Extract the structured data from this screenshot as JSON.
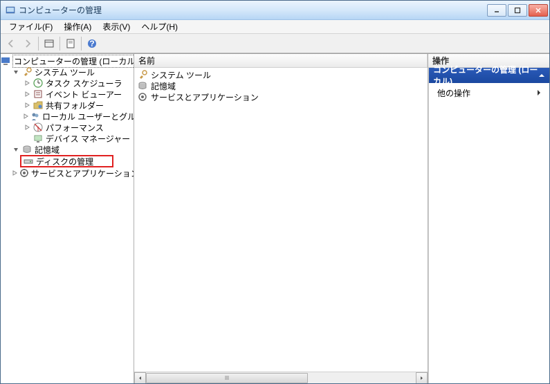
{
  "window": {
    "title": "コンピューターの管理"
  },
  "menu": {
    "file": "ファイル(F)",
    "action": "操作(A)",
    "view": "表示(V)",
    "help": "ヘルプ(H)"
  },
  "tree": {
    "root": "コンピューターの管理 (ローカル)",
    "system_tools": "システム ツール",
    "task_scheduler": "タスク スケジューラ",
    "event_viewer": "イベント ビューアー",
    "shared_folders": "共有フォルダー",
    "local_users": "ローカル ユーザーとグループ",
    "performance": "パフォーマンス",
    "device_manager": "デバイス マネージャー",
    "storage": "記憶域",
    "disk_management": "ディスクの管理",
    "services_apps": "サービスとアプリケーション"
  },
  "list": {
    "header_name": "名前",
    "items": {
      "system_tools": "システム ツール",
      "storage": "記憶域",
      "services_apps": "サービスとアプリケーション"
    }
  },
  "actions": {
    "header": "操作",
    "section": "コンピューターの管理 (ローカル)",
    "other": "他の操作"
  }
}
